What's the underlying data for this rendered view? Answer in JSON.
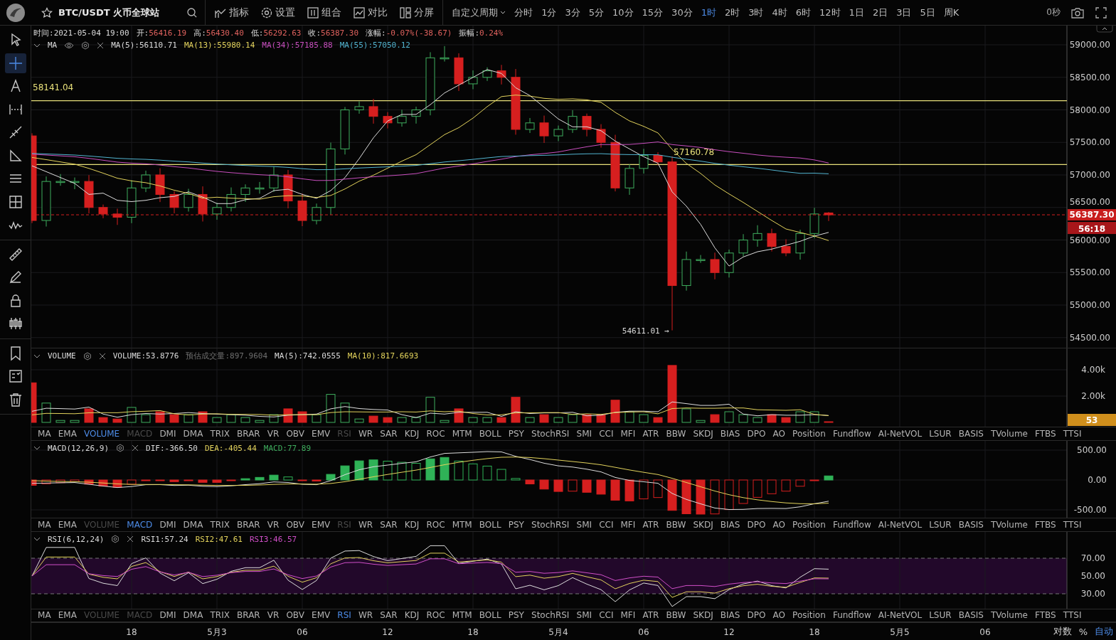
{
  "toolbar": {
    "symbol": "BTC/USDT 火币全球站",
    "menus": [
      {
        "kind": "indicator",
        "label": "指标"
      },
      {
        "kind": "settings",
        "label": "设置"
      },
      {
        "kind": "combine",
        "label": "组合"
      },
      {
        "kind": "compare",
        "label": "对比"
      },
      {
        "kind": "split",
        "label": "分屏"
      }
    ],
    "custom_period": "自定义周期",
    "periods": [
      {
        "label": "分时",
        "selected": false
      },
      {
        "label": "1分",
        "selected": false
      },
      {
        "label": "3分",
        "selected": false
      },
      {
        "label": "5分",
        "selected": false
      },
      {
        "label": "10分",
        "selected": false
      },
      {
        "label": "15分",
        "selected": false
      },
      {
        "label": "30分",
        "selected": false
      },
      {
        "label": "1时",
        "selected": true
      },
      {
        "label": "2时",
        "selected": false
      },
      {
        "label": "3时",
        "selected": false
      },
      {
        "label": "4时",
        "selected": false
      },
      {
        "label": "6时",
        "selected": false
      },
      {
        "label": "12时",
        "selected": false
      },
      {
        "label": "1日",
        "selected": false
      },
      {
        "label": "2日",
        "selected": false
      },
      {
        "label": "3日",
        "selected": false
      },
      {
        "label": "5日",
        "selected": false
      },
      {
        "label": "周K",
        "selected": false
      }
    ],
    "timer": "0秒"
  },
  "tool_groups": [
    {
      "tools": [
        {
          "kind": "pointer",
          "selected": false
        },
        {
          "kind": "crosshair",
          "selected": true
        },
        {
          "kind": "text",
          "selected": false
        },
        {
          "kind": "dotted",
          "selected": false
        },
        {
          "kind": "pen",
          "selected": false
        },
        {
          "kind": "triangle",
          "selected": false
        },
        {
          "kind": "lines",
          "selected": false
        },
        {
          "kind": "grid",
          "selected": false
        },
        {
          "kind": "wave",
          "selected": false
        }
      ]
    },
    {
      "tools": [
        {
          "kind": "ruler",
          "selected": false
        },
        {
          "kind": "brush",
          "selected": false
        },
        {
          "kind": "lock",
          "selected": false
        },
        {
          "kind": "candles",
          "selected": false
        }
      ]
    },
    {
      "tools": [
        {
          "kind": "bookmark",
          "selected": false
        },
        {
          "kind": "checklist",
          "selected": false
        },
        {
          "kind": "trash",
          "selected": false
        }
      ]
    }
  ],
  "main_pane": {
    "ohlc": [
      {
        "label": "时间:",
        "value": "2021-05-04 19:00",
        "kind": "time"
      },
      {
        "label": "开:",
        "value": "56416.19",
        "kind": "price"
      },
      {
        "label": "高:",
        "value": "56430.40",
        "kind": "price"
      },
      {
        "label": "低:",
        "value": "56292.63",
        "kind": "price"
      },
      {
        "label": "收:",
        "value": "56387.30",
        "kind": "price"
      },
      {
        "label": "涨幅:",
        "value": "-0.07%(-38.67)",
        "kind": "price"
      },
      {
        "label": "振幅:",
        "value": "0.24%",
        "kind": "price"
      }
    ],
    "indicator": "MA",
    "ma": [
      {
        "text": "MA(5):56110.71",
        "color": "#dcdcdc"
      },
      {
        "text": "MA(13):55980.14",
        "color": "#e3d35c"
      },
      {
        "text": "MA(34):57185.88",
        "color": "#c94fbf"
      },
      {
        "text": "MA(55):57050.12",
        "color": "#52b4d0"
      }
    ],
    "price_lines": [
      {
        "label": "58141.04"
      },
      {
        "label": "57160.78"
      }
    ],
    "low_marker": "54611.01 →",
    "axis": [
      "59000.00",
      "58500.00",
      "58000.00",
      "57500.00",
      "57000.00",
      "56500.00",
      "56000.00",
      "55500.00",
      "55000.00",
      "54500.00"
    ],
    "last_price": "56387.30",
    "countdown": "56:18"
  },
  "volume_pane": {
    "title": "VOLUME",
    "values": [
      {
        "text": "VOLUME:53.8776",
        "color": "#dcdcdc"
      },
      {
        "text": "预估成交量:897.9604",
        "color": "#6e6e6e"
      },
      {
        "text": "MA(5):742.0555",
        "color": "#dcdcdc"
      },
      {
        "text": "MA(10):817.6693",
        "color": "#e3d35c"
      }
    ],
    "axis": [
      "4.00k",
      "2.00k"
    ],
    "last_volume": "53"
  },
  "macd_pane": {
    "title": "MACD(12,26,9)",
    "values": [
      {
        "text": "DIF:-366.50",
        "color": "#dcdcdc"
      },
      {
        "text": "DEA:-405.44",
        "color": "#e3d35c"
      },
      {
        "text": "MACD:77.89",
        "color": "#3fae5e"
      }
    ],
    "axis": [
      "500.00",
      "0.00",
      "-500.00"
    ]
  },
  "rsi_pane": {
    "title": "RSI(6,12,24)",
    "values": [
      {
        "text": "RSI1:57.24",
        "color": "#dcdcdc"
      },
      {
        "text": "RSI2:47.61",
        "color": "#e3d35c"
      },
      {
        "text": "RSI3:46.57",
        "color": "#d04fc8"
      }
    ],
    "axis": [
      "70.00",
      "50.00",
      "30.00"
    ]
  },
  "indicator_rows": [
    {
      "tabs": [
        {
          "label": "MA",
          "selected": false,
          "disabled": false
        },
        {
          "label": "EMA",
          "selected": false,
          "disabled": false
        },
        {
          "label": "VOLUME",
          "selected": true,
          "disabled": false
        },
        {
          "label": "MACD",
          "selected": false,
          "disabled": true
        },
        {
          "label": "DMI",
          "selected": false,
          "disabled": false
        },
        {
          "label": "DMA",
          "selected": false,
          "disabled": false
        },
        {
          "label": "TRIX",
          "selected": false,
          "disabled": false
        },
        {
          "label": "BRAR",
          "selected": false,
          "disabled": false
        },
        {
          "label": "VR",
          "selected": false,
          "disabled": false
        },
        {
          "label": "OBV",
          "selected": false,
          "disabled": false
        },
        {
          "label": "EMV",
          "selected": false,
          "disabled": false
        },
        {
          "label": "RSI",
          "selected": false,
          "disabled": true
        },
        {
          "label": "WR",
          "selected": false,
          "disabled": false
        },
        {
          "label": "SAR",
          "selected": false,
          "disabled": false
        },
        {
          "label": "KDJ",
          "selected": false,
          "disabled": false
        },
        {
          "label": "ROC",
          "selected": false,
          "disabled": false
        },
        {
          "label": "MTM",
          "selected": false,
          "disabled": false
        },
        {
          "label": "BOLL",
          "selected": false,
          "disabled": false
        },
        {
          "label": "PSY",
          "selected": false,
          "disabled": false
        },
        {
          "label": "StochRSI",
          "selected": false,
          "disabled": false
        },
        {
          "label": "SMI",
          "selected": false,
          "disabled": false
        },
        {
          "label": "CCI",
          "selected": false,
          "disabled": false
        },
        {
          "label": "MFI",
          "selected": false,
          "disabled": false
        },
        {
          "label": "ATR",
          "selected": false,
          "disabled": false
        },
        {
          "label": "BBW",
          "selected": false,
          "disabled": false
        },
        {
          "label": "SKDJ",
          "selected": false,
          "disabled": false
        },
        {
          "label": "BIAS",
          "selected": false,
          "disabled": false
        },
        {
          "label": "DPO",
          "selected": false,
          "disabled": false
        },
        {
          "label": "AO",
          "selected": false,
          "disabled": false
        },
        {
          "label": "Position",
          "selected": false,
          "disabled": false
        },
        {
          "label": "Fundflow",
          "selected": false,
          "disabled": false
        },
        {
          "label": "AI-NetVOL",
          "selected": false,
          "disabled": false
        },
        {
          "label": "LSUR",
          "selected": false,
          "disabled": false
        },
        {
          "label": "BASIS",
          "selected": false,
          "disabled": false
        },
        {
          "label": "TVolume",
          "selected": false,
          "disabled": false
        },
        {
          "label": "FTBS",
          "selected": false,
          "disabled": false
        },
        {
          "label": "TTSI",
          "selected": false,
          "disabled": false
        }
      ]
    },
    {
      "tabs": [
        {
          "label": "MA",
          "selected": false,
          "disabled": false
        },
        {
          "label": "EMA",
          "selected": false,
          "disabled": false
        },
        {
          "label": "VOLUME",
          "selected": false,
          "disabled": true
        },
        {
          "label": "MACD",
          "selected": true,
          "disabled": false
        },
        {
          "label": "DMI",
          "selected": false,
          "disabled": false
        },
        {
          "label": "DMA",
          "selected": false,
          "disabled": false
        },
        {
          "label": "TRIX",
          "selected": false,
          "disabled": false
        },
        {
          "label": "BRAR",
          "selected": false,
          "disabled": false
        },
        {
          "label": "VR",
          "selected": false,
          "disabled": false
        },
        {
          "label": "OBV",
          "selected": false,
          "disabled": false
        },
        {
          "label": "EMV",
          "selected": false,
          "disabled": false
        },
        {
          "label": "RSI",
          "selected": false,
          "disabled": true
        },
        {
          "label": "WR",
          "selected": false,
          "disabled": false
        },
        {
          "label": "SAR",
          "selected": false,
          "disabled": false
        },
        {
          "label": "KDJ",
          "selected": false,
          "disabled": false
        },
        {
          "label": "ROC",
          "selected": false,
          "disabled": false
        },
        {
          "label": "MTM",
          "selected": false,
          "disabled": false
        },
        {
          "label": "BOLL",
          "selected": false,
          "disabled": false
        },
        {
          "label": "PSY",
          "selected": false,
          "disabled": false
        },
        {
          "label": "StochRSI",
          "selected": false,
          "disabled": false
        },
        {
          "label": "SMI",
          "selected": false,
          "disabled": false
        },
        {
          "label": "CCI",
          "selected": false,
          "disabled": false
        },
        {
          "label": "MFI",
          "selected": false,
          "disabled": false
        },
        {
          "label": "ATR",
          "selected": false,
          "disabled": false
        },
        {
          "label": "BBW",
          "selected": false,
          "disabled": false
        },
        {
          "label": "SKDJ",
          "selected": false,
          "disabled": false
        },
        {
          "label": "BIAS",
          "selected": false,
          "disabled": false
        },
        {
          "label": "DPO",
          "selected": false,
          "disabled": false
        },
        {
          "label": "AO",
          "selected": false,
          "disabled": false
        },
        {
          "label": "Position",
          "selected": false,
          "disabled": false
        },
        {
          "label": "Fundflow",
          "selected": false,
          "disabled": false
        },
        {
          "label": "AI-NetVOL",
          "selected": false,
          "disabled": false
        },
        {
          "label": "LSUR",
          "selected": false,
          "disabled": false
        },
        {
          "label": "BASIS",
          "selected": false,
          "disabled": false
        },
        {
          "label": "TVolume",
          "selected": false,
          "disabled": false
        },
        {
          "label": "FTBS",
          "selected": false,
          "disabled": false
        },
        {
          "label": "TTSI",
          "selected": false,
          "disabled": false
        }
      ]
    },
    {
      "tabs": [
        {
          "label": "MA",
          "selected": false,
          "disabled": false
        },
        {
          "label": "EMA",
          "selected": false,
          "disabled": false
        },
        {
          "label": "VOLUME",
          "selected": false,
          "disabled": true
        },
        {
          "label": "MACD",
          "selected": false,
          "disabled": true
        },
        {
          "label": "DMI",
          "selected": false,
          "disabled": false
        },
        {
          "label": "DMA",
          "selected": false,
          "disabled": false
        },
        {
          "label": "TRIX",
          "selected": false,
          "disabled": false
        },
        {
          "label": "BRAR",
          "selected": false,
          "disabled": false
        },
        {
          "label": "VR",
          "selected": false,
          "disabled": false
        },
        {
          "label": "OBV",
          "selected": false,
          "disabled": false
        },
        {
          "label": "EMV",
          "selected": false,
          "disabled": false
        },
        {
          "label": "RSI",
          "selected": true,
          "disabled": false
        },
        {
          "label": "WR",
          "selected": false,
          "disabled": false
        },
        {
          "label": "SAR",
          "selected": false,
          "disabled": false
        },
        {
          "label": "KDJ",
          "selected": false,
          "disabled": false
        },
        {
          "label": "ROC",
          "selected": false,
          "disabled": false
        },
        {
          "label": "MTM",
          "selected": false,
          "disabled": false
        },
        {
          "label": "BOLL",
          "selected": false,
          "disabled": false
        },
        {
          "label": "PSY",
          "selected": false,
          "disabled": false
        },
        {
          "label": "StochRSI",
          "selected": false,
          "disabled": false
        },
        {
          "label": "SMI",
          "selected": false,
          "disabled": false
        },
        {
          "label": "CCI",
          "selected": false,
          "disabled": false
        },
        {
          "label": "MFI",
          "selected": false,
          "disabled": false
        },
        {
          "label": "ATR",
          "selected": false,
          "disabled": false
        },
        {
          "label": "BBW",
          "selected": false,
          "disabled": false
        },
        {
          "label": "SKDJ",
          "selected": false,
          "disabled": false
        },
        {
          "label": "BIAS",
          "selected": false,
          "disabled": false
        },
        {
          "label": "DPO",
          "selected": false,
          "disabled": false
        },
        {
          "label": "AO",
          "selected": false,
          "disabled": false
        },
        {
          "label": "Position",
          "selected": false,
          "disabled": false
        },
        {
          "label": "Fundflow",
          "selected": false,
          "disabled": false
        },
        {
          "label": "AI-NetVOL",
          "selected": false,
          "disabled": false
        },
        {
          "label": "LSUR",
          "selected": false,
          "disabled": false
        },
        {
          "label": "BASIS",
          "selected": false,
          "disabled": false
        },
        {
          "label": "TVolume",
          "selected": false,
          "disabled": false
        },
        {
          "label": "FTBS",
          "selected": false,
          "disabled": false
        },
        {
          "label": "TTSI",
          "selected": false,
          "disabled": false
        }
      ]
    }
  ],
  "time_axis": [
    "18",
    "5月3",
    "06",
    "12",
    "18",
    "5月4",
    "06",
    "12",
    "18",
    "5月5",
    "06"
  ],
  "scale_options": [
    {
      "label": "对数",
      "selected": false
    },
    {
      "label": "%",
      "selected": false
    },
    {
      "label": "自动",
      "selected": true
    }
  ]
}
